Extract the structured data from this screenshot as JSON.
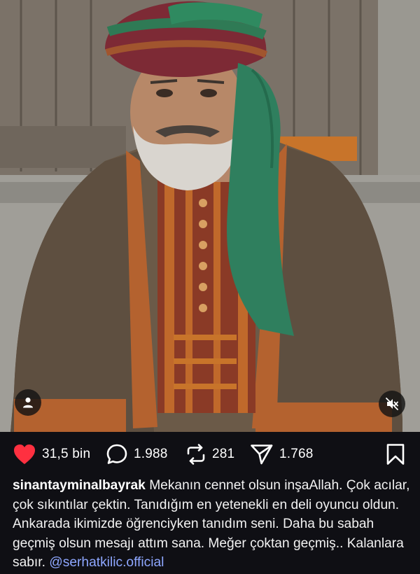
{
  "post": {
    "image_alt": "Actor in Ottoman costume with turban and green scarf",
    "stats": {
      "likes": "31,5 bin",
      "comments": "1.988",
      "reposts": "281",
      "shares": "1.768"
    },
    "caption": {
      "username": "sinantayminalbayrak",
      "text": "Mekanın cennet olsun inşaAllah. Çok acılar, çok sıkıntılar çektin. Tanıdığım en yetenekli en deli oyuncu oldun. Ankarada ikimizde öğrenciyken tanıdım seni. Daha bu sabah geçmiş olsun mesajı attım sana. Meğer çoktan geçmiş.. Kalanlara sabır.",
      "mention": "@serhatkilic.official"
    }
  },
  "colors": {
    "background": "#0f0f14",
    "like": "#ff3040",
    "mention": "#8ea7ff"
  },
  "icons": [
    "heart-icon",
    "comment-icon",
    "repost-icon",
    "share-icon",
    "bookmark-icon",
    "user-tag-icon",
    "muted-speaker-icon"
  ]
}
